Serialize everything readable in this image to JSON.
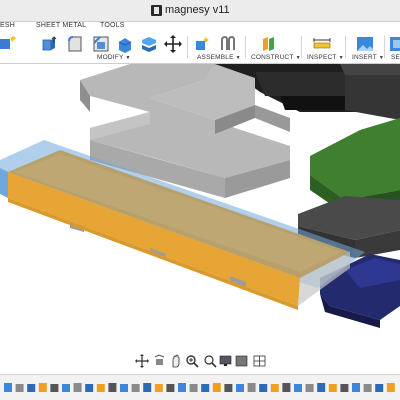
{
  "window": {
    "title": "magnesy v11"
  },
  "tabs": [
    {
      "label": "ESH"
    },
    {
      "label": "SHEET METAL"
    },
    {
      "label": "TOOLS"
    }
  ],
  "toolbar": {
    "groups": [
      {
        "label": "MODIFY"
      },
      {
        "label": "ASSEMBLE"
      },
      {
        "label": "CONSTRUCT"
      },
      {
        "label": "INSPECT"
      },
      {
        "label": "INSERT"
      },
      {
        "label": "SE"
      }
    ]
  },
  "colors": {
    "selection_highlight": "#6fa8dc",
    "orange_body": "#e6a534",
    "grey_body": "#b8b8b8",
    "dark_body": "#2a2a2a",
    "green_body": "#3f7f2f",
    "navy_body": "#222a6e"
  },
  "navbar": {
    "icons": [
      "orbit-icon",
      "look-at-icon",
      "pan-icon",
      "zoom-icon",
      "fit-icon",
      "display-settings-icon",
      "visual-style-icon",
      "grid-icon"
    ]
  },
  "timeline": {
    "icons": [
      "timeline-start-icon",
      "timeline-feature-icon"
    ]
  }
}
